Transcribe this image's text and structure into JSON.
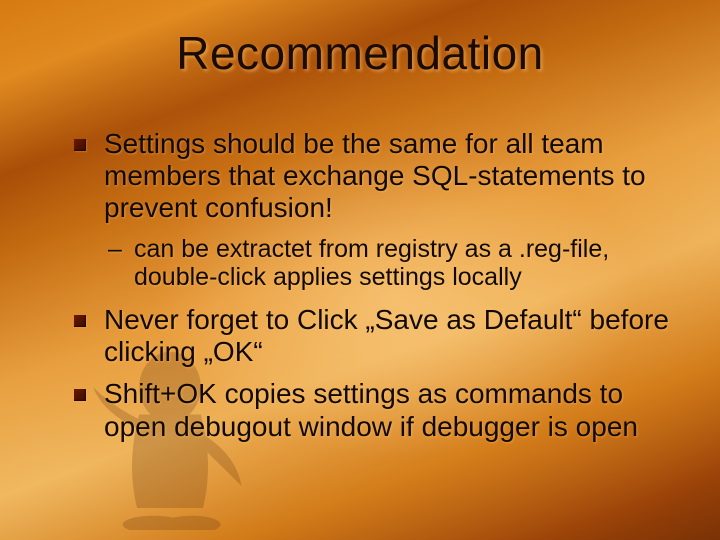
{
  "title": "Recommendation",
  "bullets": {
    "b1": "Settings should be the same for all team members that exchange SQL-statements to prevent confusion!",
    "b1_sub": "can be extractet from registry as a .reg-file, double-click applies settings locally",
    "b2": "Never forget to Click „Save as Default“ before clicking „OK“",
    "b3": "Shift+OK copies settings as commands to open debugout window if debugger is open"
  },
  "dash": "–"
}
